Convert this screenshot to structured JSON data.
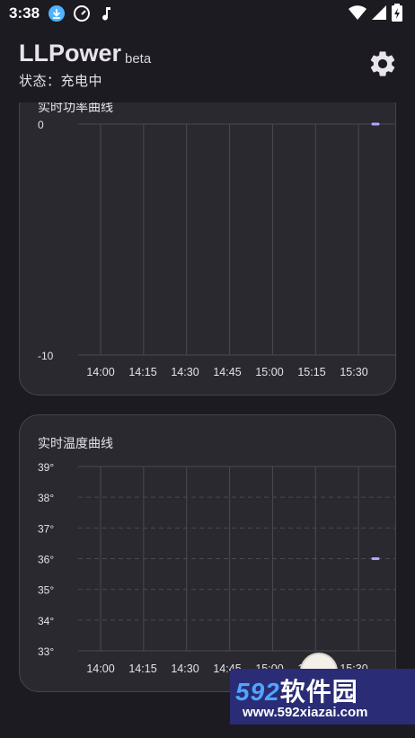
{
  "status_bar": {
    "time": "3:38",
    "left_icons": [
      "download-icon",
      "speedometer-icon",
      "music-note-icon"
    ],
    "right_icons": [
      "wifi-icon",
      "cell-signal-icon",
      "battery-charging-icon"
    ]
  },
  "header": {
    "title": "LLPower",
    "badge": "beta",
    "status": "状态：充电中",
    "settings_icon": "gear-icon"
  },
  "chart_data": [
    {
      "type": "line",
      "title": "实时功率曲线",
      "x_ticks": [
        "14:00",
        "14:15",
        "14:30",
        "14:45",
        "15:00",
        "15:15",
        "15:30"
      ],
      "y_ticks": [
        "0",
        "-10"
      ],
      "ylim": [
        -10,
        0
      ],
      "series": [
        {
          "values": [
            0
          ]
        }
      ],
      "accent_color": "#b3a6ff"
    },
    {
      "type": "line",
      "title": "实时温度曲线",
      "x_ticks": [
        "14:00",
        "14:15",
        "14:30",
        "14:45",
        "15:00",
        "15:15",
        "15:30"
      ],
      "y_ticks": [
        "39°",
        "38°",
        "37°",
        "36°",
        "35°",
        "34°",
        "33°"
      ],
      "ylim": [
        33,
        39
      ],
      "series": [
        {
          "values": [
            36
          ]
        }
      ],
      "accent_color": "#b3a6ff"
    }
  ],
  "watermark": {
    "brand_number": "592",
    "brand_text": "软件园",
    "url": "www.592xiazai.com"
  },
  "colors": {
    "background": "#1c1b21",
    "card": "#2a2930",
    "grid": "#4a4852",
    "text": "#e6e1e8"
  }
}
